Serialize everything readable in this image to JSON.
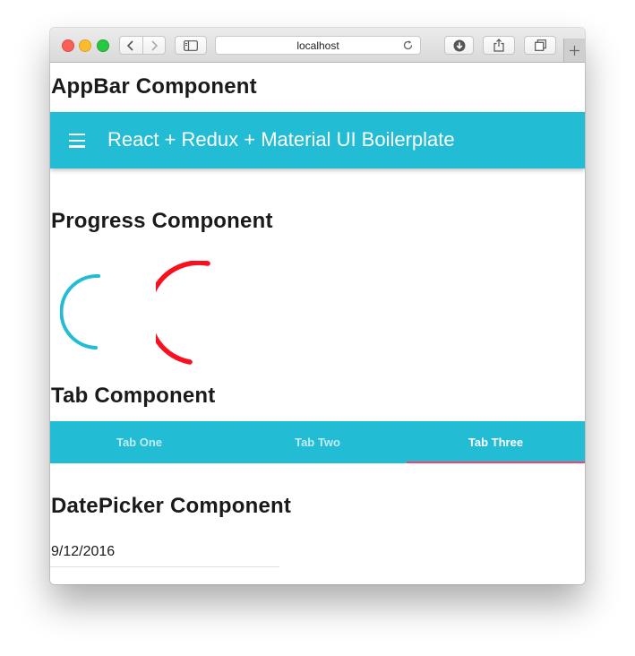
{
  "browser": {
    "address": "localhost",
    "icons": [
      "back-icon",
      "forward-icon",
      "sidebar-icon",
      "reload-icon",
      "download-icon",
      "share-icon",
      "tabs-icon",
      "new-tab-icon"
    ]
  },
  "sections": {
    "appbar_heading": "AppBar Component",
    "progress_heading": "Progress Component",
    "tab_heading": "Tab Component",
    "datepicker_heading": "DatePicker Component"
  },
  "appbar": {
    "title": "React + Redux + Material UI Boilerplate",
    "color": "#22bcd4",
    "menu_icon": "menu-icon"
  },
  "progress": {
    "spinners": [
      {
        "color": "#22bcd4",
        "type": "indeterminate"
      },
      {
        "color": "#f8101e",
        "type": "indeterminate"
      }
    ]
  },
  "tabs": {
    "items": [
      {
        "label": "Tab One",
        "active": false
      },
      {
        "label": "Tab Two",
        "active": false
      },
      {
        "label": "Tab Three",
        "active": true
      }
    ],
    "indicator_color": "#ff3d6a"
  },
  "datepicker": {
    "value": "9/12/2016"
  }
}
